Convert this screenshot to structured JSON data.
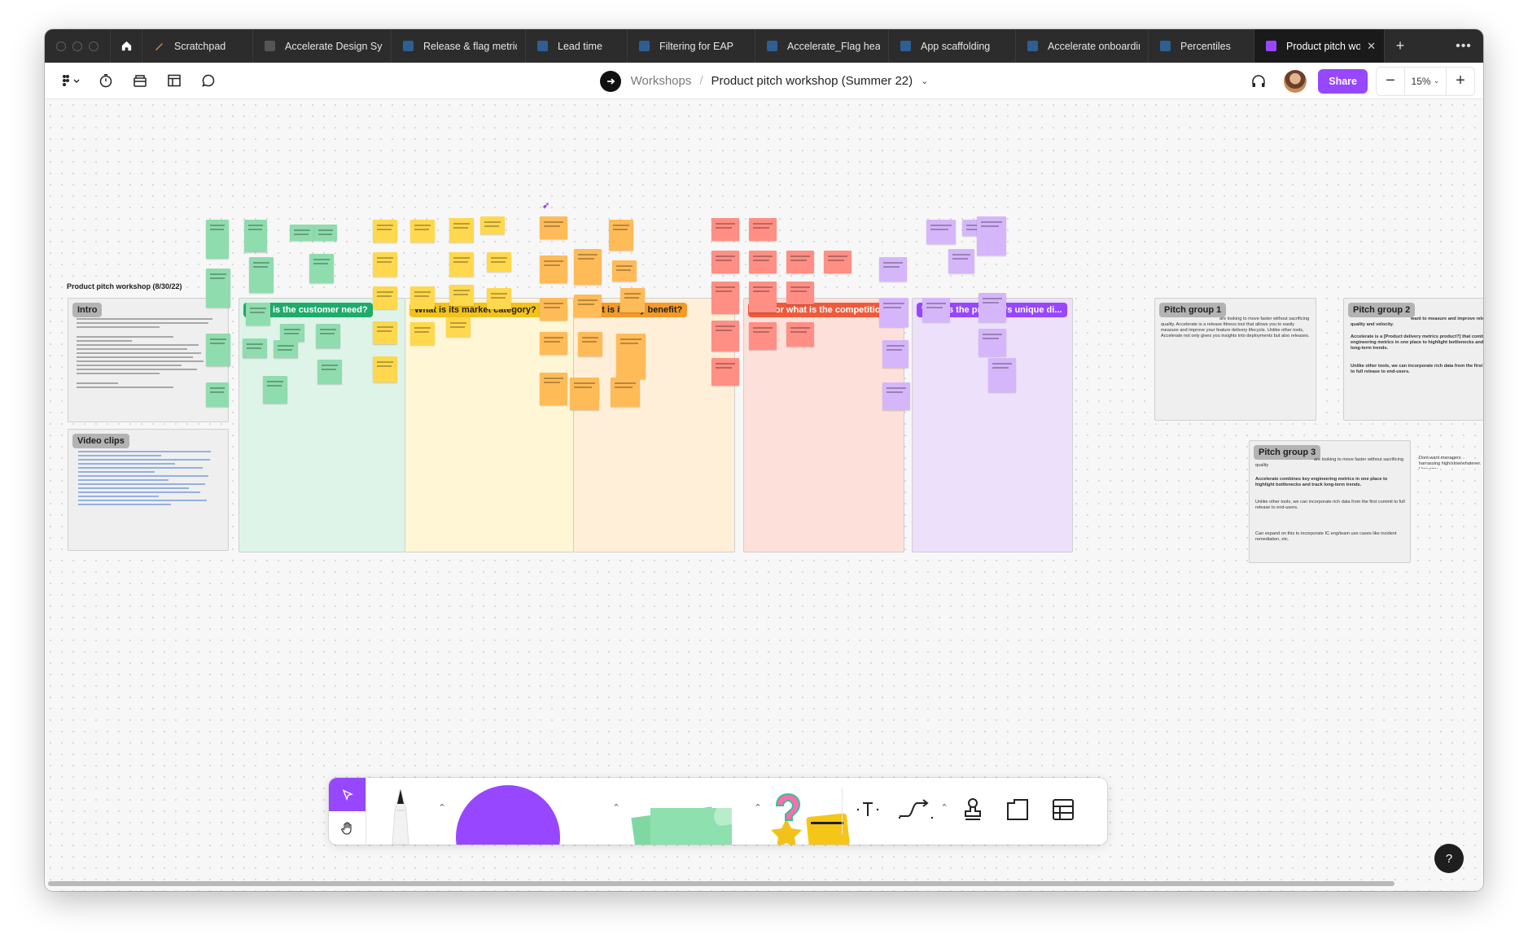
{
  "tabs": [
    {
      "label": "Scratchpad",
      "icon": "pen-icon",
      "color": "#c58b44",
      "active": false
    },
    {
      "label": "Accelerate Design Sy",
      "icon": "file-icon",
      "color": "#7a7a7a",
      "active": false
    },
    {
      "label": "Release & flag metric",
      "icon": "file-icon",
      "color": "#4a90d9",
      "active": false
    },
    {
      "label": "Lead time",
      "icon": "file-icon",
      "color": "#4a90d9",
      "active": false
    },
    {
      "label": "Filtering for EAP",
      "icon": "file-icon",
      "color": "#4a90d9",
      "active": false
    },
    {
      "label": "Accelerate_Flag healt",
      "icon": "file-icon",
      "color": "#4a90d9",
      "active": false
    },
    {
      "label": "App scaffolding",
      "icon": "file-icon",
      "color": "#4a90d9",
      "active": false
    },
    {
      "label": "Accelerate onboardin",
      "icon": "file-icon",
      "color": "#4a90d9",
      "active": false
    },
    {
      "label": "Percentiles",
      "icon": "file-icon",
      "color": "#4a90d9",
      "active": false
    },
    {
      "label": "Product pitch work",
      "icon": "figjam-icon",
      "color": "#9747ff",
      "active": true
    }
  ],
  "toolbar": {
    "breadcrumb_parent": "Workshops",
    "separator": "/",
    "file_name": "Product pitch workshop (Summer 22)",
    "share_label": "Share",
    "zoom": "15%"
  },
  "board": {
    "title": "Product pitch workshop (8/30/22)",
    "sections": {
      "intro": "Intro",
      "video": "Video clips",
      "need": "What is the customer need?",
      "market": "What is its market category?",
      "benefit": "What is its key benefit?",
      "competition": "Who or what is the competition?",
      "unique": "What is the product's unique di...",
      "pitch1": "Pitch group 1",
      "pitch2": "Pitch group 2",
      "pitch3": "Pitch group 3"
    },
    "pitch1_text": "are looking to move faster without sacrificing quality. Accelerate is a release fitness tool that allows you to easily measure and improve your feature delivery lifecycle. Unlike other tools, Accelerate not only gives you insights into deployments but also releases.",
    "pitch2_text_a": "want to measure and improve release quality and velocity.",
    "pitch2_text_b": "Accelerate is a [Product delivery metrics product?] that combines key engineering metrics in one place to highlight bottlenecks and track long-term trends.",
    "pitch2_text_c": "Unlike other tools, we can incorporate rich data from the first commit to full release to end-users.",
    "pitch3_text_a": "are looking to move faster without sacrificing quality",
    "pitch3_text_b": "Accelerate combines key engineering metrics in one place to highlight bottlenecks and track long-term trends.",
    "pitch3_text_c": "Unlike other tools, we can incorporate rich data from the first commit to full release to end-users.",
    "pitch3_text_d": "Can expand on this to incorporate IC eng/team use cases like incident remediation, etc.",
    "side_note": "Dont want managers harrassing high/slow/whatever. How wou"
  },
  "colors": {
    "accent": "#9747ff",
    "need": "#1fab6b",
    "market": "#f2c21b",
    "benefit": "#f39a2a",
    "competition": "#ef5a3c",
    "unique": "#9747ff"
  }
}
